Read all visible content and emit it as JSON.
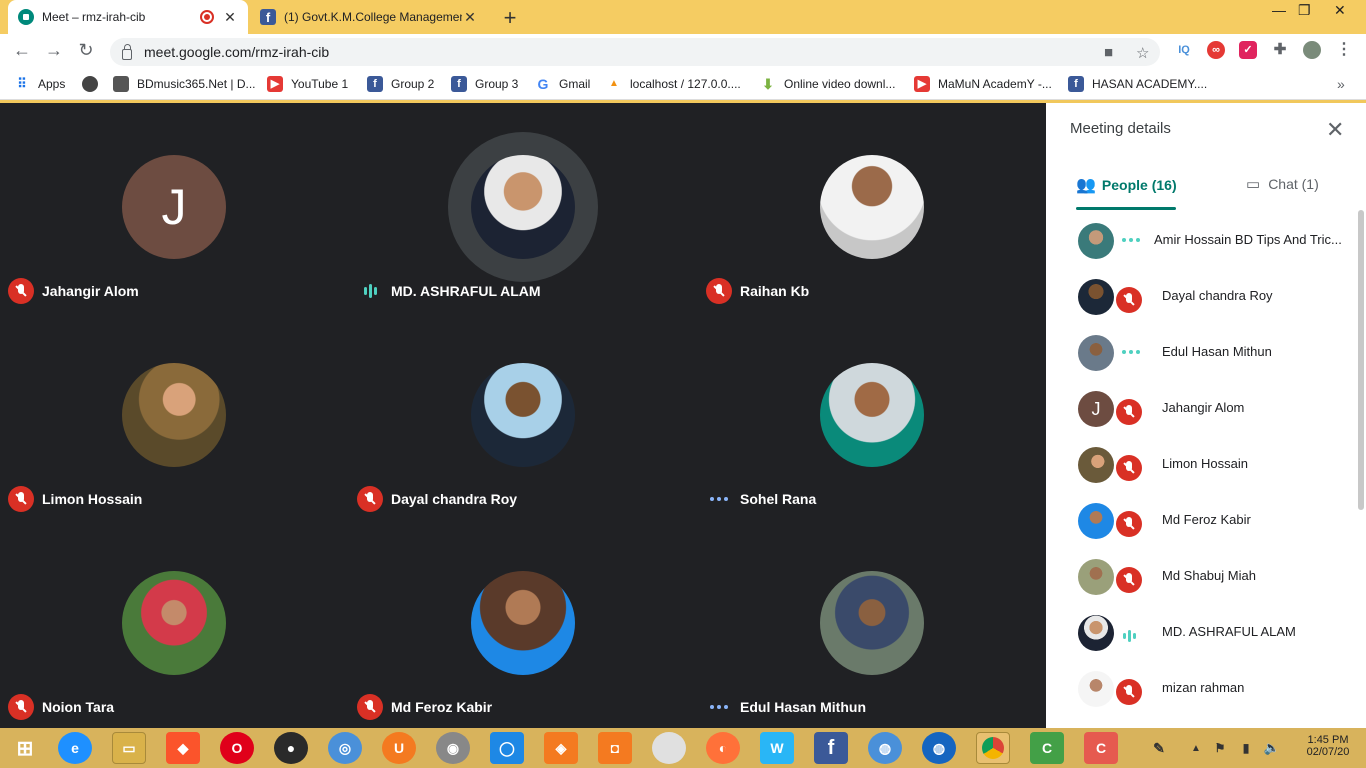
{
  "browser": {
    "tabs": [
      {
        "title": "Meet – rmz-irah-cib"
      },
      {
        "title": "(1) Govt.K.M.College Managemen"
      }
    ],
    "url": "meet.google.com/rmz-irah-cib",
    "bookmarks": [
      {
        "label": "Apps"
      },
      {
        "label": "BDmusic365.Net | D..."
      },
      {
        "label": "YouTube  1"
      },
      {
        "label": "Group 2"
      },
      {
        "label": "Group 3"
      },
      {
        "label": "Gmail"
      },
      {
        "label": "localhost / 127.0.0...."
      },
      {
        "label": "Online video downl..."
      },
      {
        "label": "MaMuN AcademY -..."
      },
      {
        "label": "HASAN ACADEMY...."
      }
    ]
  },
  "meeting": {
    "tiles": [
      {
        "name": "Jahangir Alom",
        "status": "muted",
        "letter": "J"
      },
      {
        "name": "MD. ASHRAFUL ALAM",
        "status": "speaking"
      },
      {
        "name": "Raihan Kb",
        "status": "muted"
      },
      {
        "name": "Limon Hossain",
        "status": "muted"
      },
      {
        "name": "Dayal chandra Roy",
        "status": "muted"
      },
      {
        "name": "Sohel Rana",
        "status": "idle"
      },
      {
        "name": "Noion Tara",
        "status": "muted"
      },
      {
        "name": "Md Feroz Kabir",
        "status": "muted"
      },
      {
        "name": "Edul Hasan Mithun",
        "status": "idle"
      }
    ]
  },
  "panel": {
    "title": "Meeting details",
    "people_tab": "People (16)",
    "chat_tab": "Chat (1)",
    "people": [
      {
        "name": "Amir Hossain BD Tips And Tric...",
        "status": "idle"
      },
      {
        "name": "Dayal chandra Roy",
        "status": "muted"
      },
      {
        "name": "Edul Hasan Mithun",
        "status": "idle"
      },
      {
        "name": "Jahangir Alom",
        "status": "muted",
        "letter": "J"
      },
      {
        "name": "Limon Hossain",
        "status": "muted"
      },
      {
        "name": "Md Feroz Kabir",
        "status": "muted"
      },
      {
        "name": "Md Shabuj Miah",
        "status": "muted"
      },
      {
        "name": "MD. ASHRAFUL ALAM",
        "status": "speaking"
      },
      {
        "name": "mizan rahman",
        "status": "muted"
      }
    ]
  },
  "taskbar": {
    "time": "1:45 PM",
    "date": "02/07/20"
  }
}
